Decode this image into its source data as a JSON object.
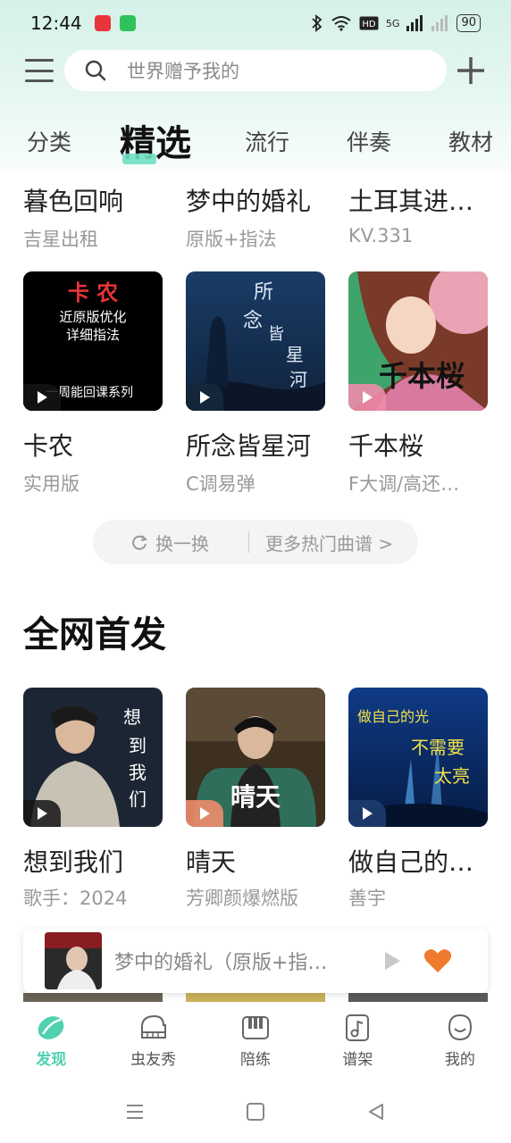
{
  "status_bar": {
    "time": "12:44",
    "network": "5G",
    "battery": "90"
  },
  "search": {
    "placeholder": "世界赠予我的"
  },
  "tabs": [
    {
      "label": "分类"
    },
    {
      "label": "精选"
    },
    {
      "label": "流行"
    },
    {
      "label": "伴奏"
    },
    {
      "label": "教材"
    }
  ],
  "top_row": [
    {
      "title": "暮色回响",
      "subtitle": "吉星出租"
    },
    {
      "title": "梦中的婚礼",
      "subtitle": "原版+指法"
    },
    {
      "title": "土耳其进…",
      "subtitle": "KV.331"
    }
  ],
  "hot_row": [
    {
      "title": "卡农",
      "subtitle": "实用版",
      "cover_text": [
        "卡 农",
        "近原版优化",
        "详细指法",
        "一周能回课系列"
      ]
    },
    {
      "title": "所念皆星河",
      "subtitle": "C调易弹",
      "cover_text": [
        "所",
        "念",
        "皆",
        "星",
        "河"
      ]
    },
    {
      "title": "千本桜",
      "subtitle": "F大调/高还…",
      "cover_text": [
        "千本桜"
      ]
    }
  ],
  "refresh": {
    "swap_label": "换一换",
    "more_label": "更多热门曲谱 >"
  },
  "section": {
    "title": "全网首发"
  },
  "new_row": [
    {
      "title": "想到我们",
      "subtitle": "歌手：2024",
      "cover_text": [
        "想",
        "到",
        "我",
        "们"
      ]
    },
    {
      "title": "晴天",
      "subtitle": "芳卿颜爆燃版",
      "cover_text": [
        "晴天"
      ]
    },
    {
      "title": "做自己的…",
      "subtitle": "善宇",
      "cover_text": [
        "做自己的光",
        "不需要",
        "太亮"
      ]
    }
  ],
  "mini_player": {
    "title": "梦中的婚礼（原版+指…"
  },
  "bottom_nav": [
    {
      "label": "发现",
      "icon": "discover-icon",
      "active": true
    },
    {
      "label": "虫友秀",
      "icon": "piano-icon",
      "active": false
    },
    {
      "label": "陪练",
      "icon": "keyboard-icon",
      "active": false
    },
    {
      "label": "谱架",
      "icon": "music-note-icon",
      "active": false
    },
    {
      "label": "我的",
      "icon": "face-icon",
      "active": false
    }
  ],
  "colors": {
    "accent": "#4fd1b0",
    "heart": "#f07a2e"
  }
}
